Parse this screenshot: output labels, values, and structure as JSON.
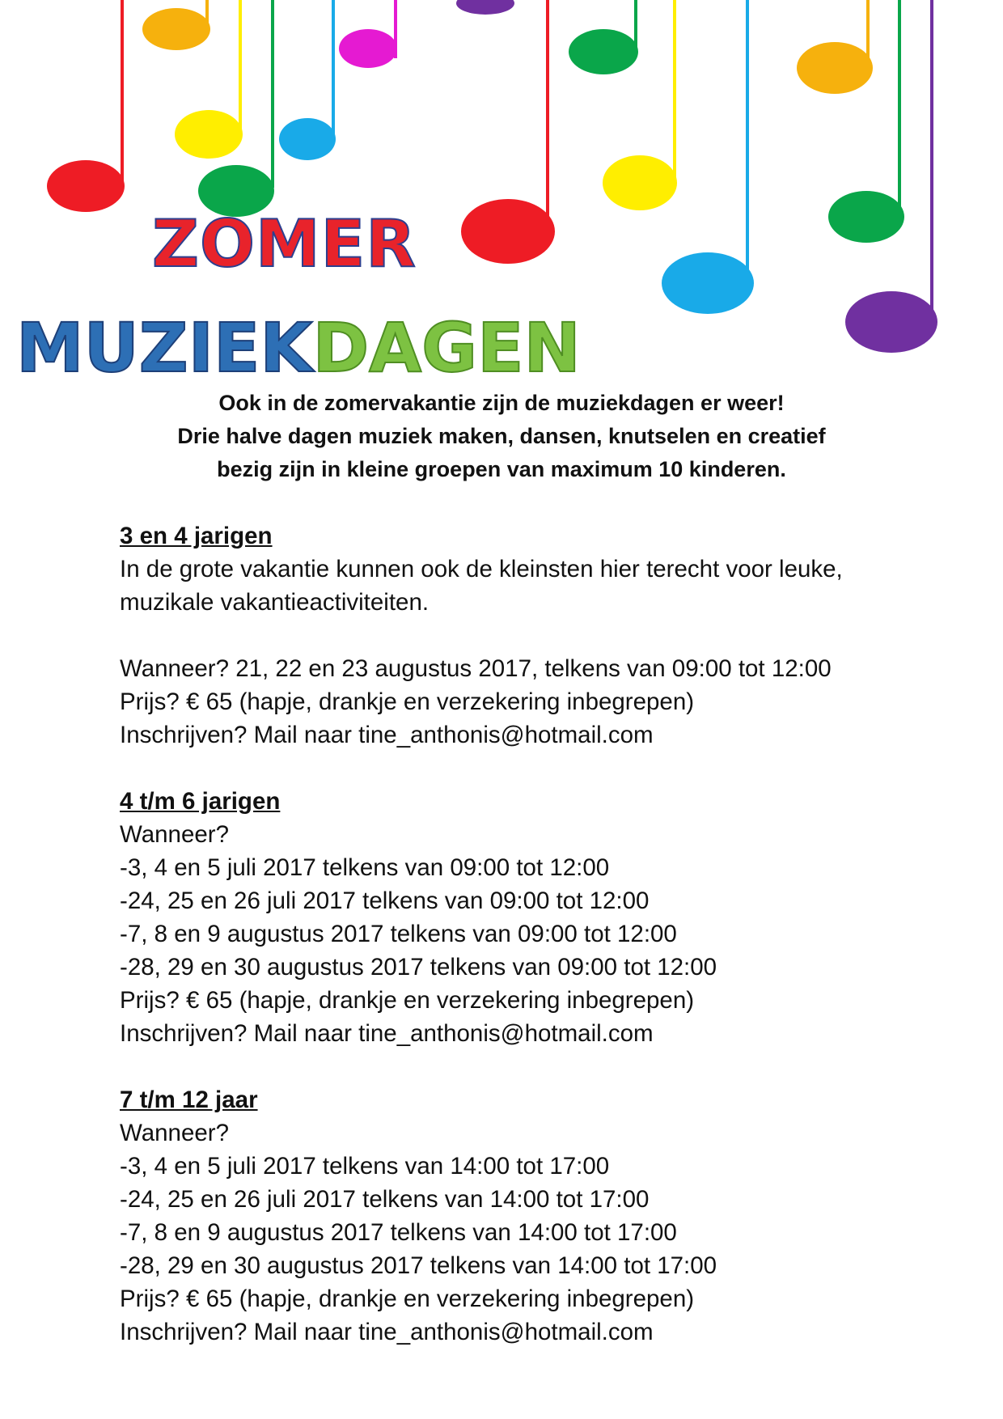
{
  "header": {
    "title_line1": "ZOMER",
    "title_line2_part1": "MUZIEK",
    "title_line2_part2": "DAGEN",
    "title_colors": {
      "zomer": "#e8232b",
      "muziek": "#2d6fb5",
      "dagen": "#7dc242"
    },
    "decoration": {
      "icon": "music-notes-decoration",
      "note_colors": [
        "#ee1c25",
        "#f6b10d",
        "#ffee00",
        "#0aa64a",
        "#e51ad2",
        "#19aae8",
        "#7030a0"
      ]
    }
  },
  "intro": {
    "lines": [
      "Ook in de zomervakantie zijn de muziekdagen er weer!",
      "Drie halve dagen muziek maken, dansen, knutselen en creatief",
      "bezig zijn in kleine groepen van maximum 10 kinderen."
    ]
  },
  "sections": [
    {
      "title": "3 en 4 jarigen",
      "description": [
        "In de grote vakantie kunnen ook de kleinsten hier terecht voor leuke,",
        "muzikale vakantieactiviteiten."
      ],
      "when": "Wanneer? 21, 22 en 23 augustus 2017, telkens van 09:00 tot 12:00",
      "price": "Prijs? € 65 (hapje, drankje en verzekering inbegrepen)",
      "register": "Inschrijven? Mail naar tine_anthonis@hotmail.com"
    },
    {
      "title": "4 t/m 6 jarigen",
      "when_label": "Wanneer?",
      "dates": [
        "-3, 4 en 5 juli 2017 telkens van 09:00 tot 12:00",
        "-24, 25 en 26 juli 2017 telkens van 09:00 tot 12:00",
        "-7, 8 en 9 augustus 2017 telkens van 09:00 tot 12:00",
        "-28, 29 en 30 augustus 2017 telkens van 09:00 tot 12:00"
      ],
      "price": "Prijs? € 65 (hapje, drankje en verzekering inbegrepen)",
      "register": "Inschrijven? Mail naar tine_anthonis@hotmail.com"
    },
    {
      "title": "7 t/m 12 jaar",
      "when_label": "Wanneer?",
      "dates": [
        "-3, 4 en 5 juli 2017 telkens van 14:00 tot 17:00",
        "-24, 25 en 26 juli 2017 telkens van 14:00 tot 17:00",
        "-7, 8 en 9 augustus 2017 telkens van 14:00 tot 17:00",
        "-28, 29 en 30 augustus 2017 telkens van 14:00 tot 17:00"
      ],
      "price": "Prijs? € 65 (hapje, drankje en verzekering inbegrepen)",
      "register": "Inschrijven? Mail naar tine_anthonis@hotmail.com"
    }
  ]
}
